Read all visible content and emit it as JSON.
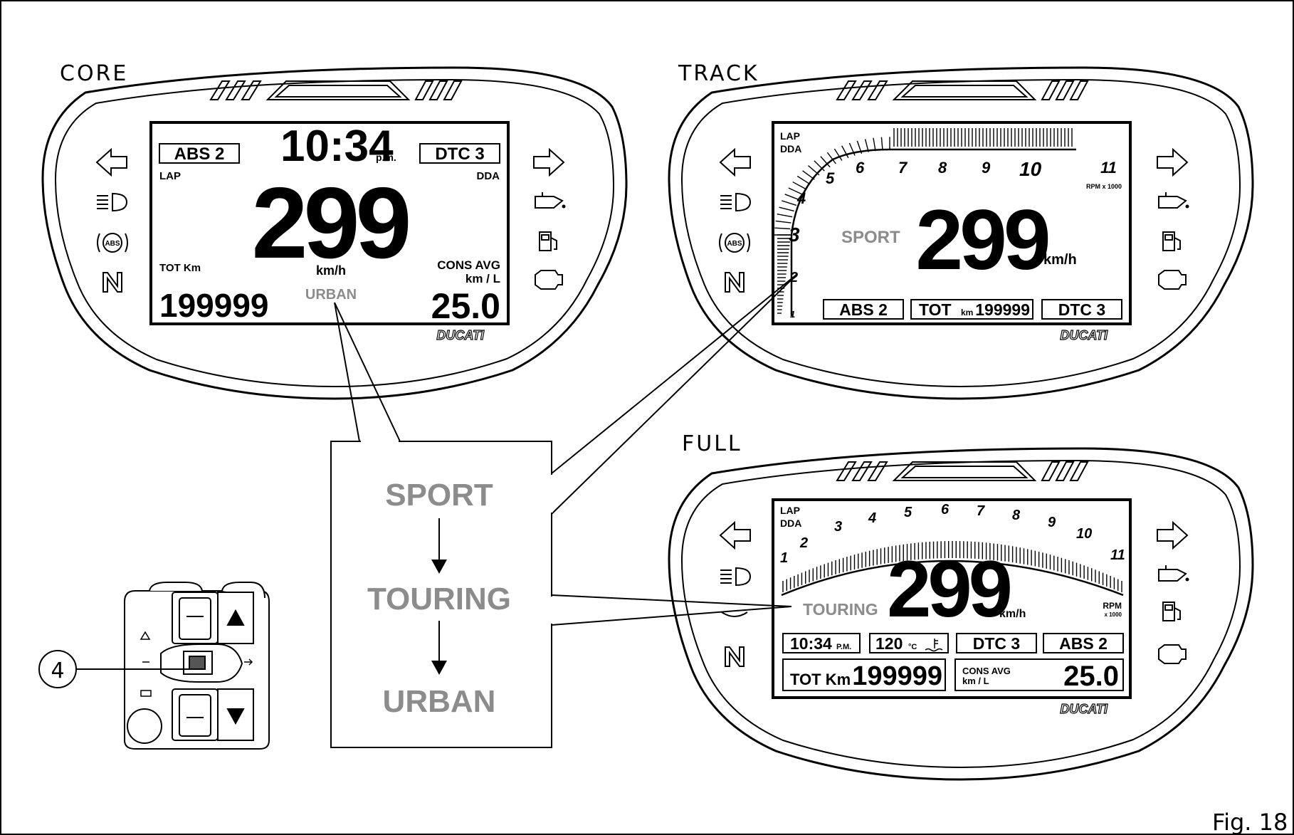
{
  "figure": {
    "fig_label": "Fig. 18",
    "callout_number": "4"
  },
  "modes": {
    "core_label": "CORE",
    "track_label": "TRACK",
    "full_label": "FULL"
  },
  "sequence": {
    "items": [
      "SPORT",
      "TOURING",
      "URBAN"
    ]
  },
  "brand": "DUCATI",
  "core": {
    "abs": "ABS 2",
    "time": "10:34",
    "ampm": "p.m.",
    "dtc": "DTC 3",
    "lap": "LAP",
    "dda": "DDA",
    "speed": "299",
    "speed_unit": "km/h",
    "tot_label": "TOT Km",
    "odometer": "199999",
    "mode": "URBAN",
    "cons_label": "CONS AVG",
    "cons_unit": "km / L",
    "cons_value": "25.0"
  },
  "track": {
    "lap": "LAP",
    "dda": "DDA",
    "rpm_ticks": [
      "1",
      "2",
      "3",
      "4",
      "5",
      "6",
      "7",
      "8",
      "9",
      "10",
      "11"
    ],
    "rpm_unit": "RPM x 1000",
    "mode": "SPORT",
    "speed": "299",
    "speed_unit": "km/h",
    "abs": "ABS 2",
    "tot": "TOT",
    "km": "km",
    "odometer": "199999",
    "dtc": "DTC 3"
  },
  "full": {
    "lap": "LAP",
    "dda": "DDA",
    "rpm_ticks": [
      "1",
      "2",
      "3",
      "4",
      "5",
      "6",
      "7",
      "8",
      "9",
      "10",
      "11"
    ],
    "rpm_unit": "RPM",
    "rpm_unit2": "x 1000",
    "mode": "TOURING",
    "speed": "299",
    "speed_unit": "km/h",
    "time": "10:34",
    "ampm": "P.M.",
    "temp": "120",
    "temp_unit": "°C",
    "dtc": "DTC 3",
    "abs": "ABS 2",
    "tot_label": "TOT Km",
    "odometer": "199999",
    "cons_label": "CONS AVG",
    "cons_unit": "km / L",
    "cons_value": "25.0"
  },
  "colors": {
    "mode_gray": "#8c8c8c",
    "line": "#000000"
  }
}
